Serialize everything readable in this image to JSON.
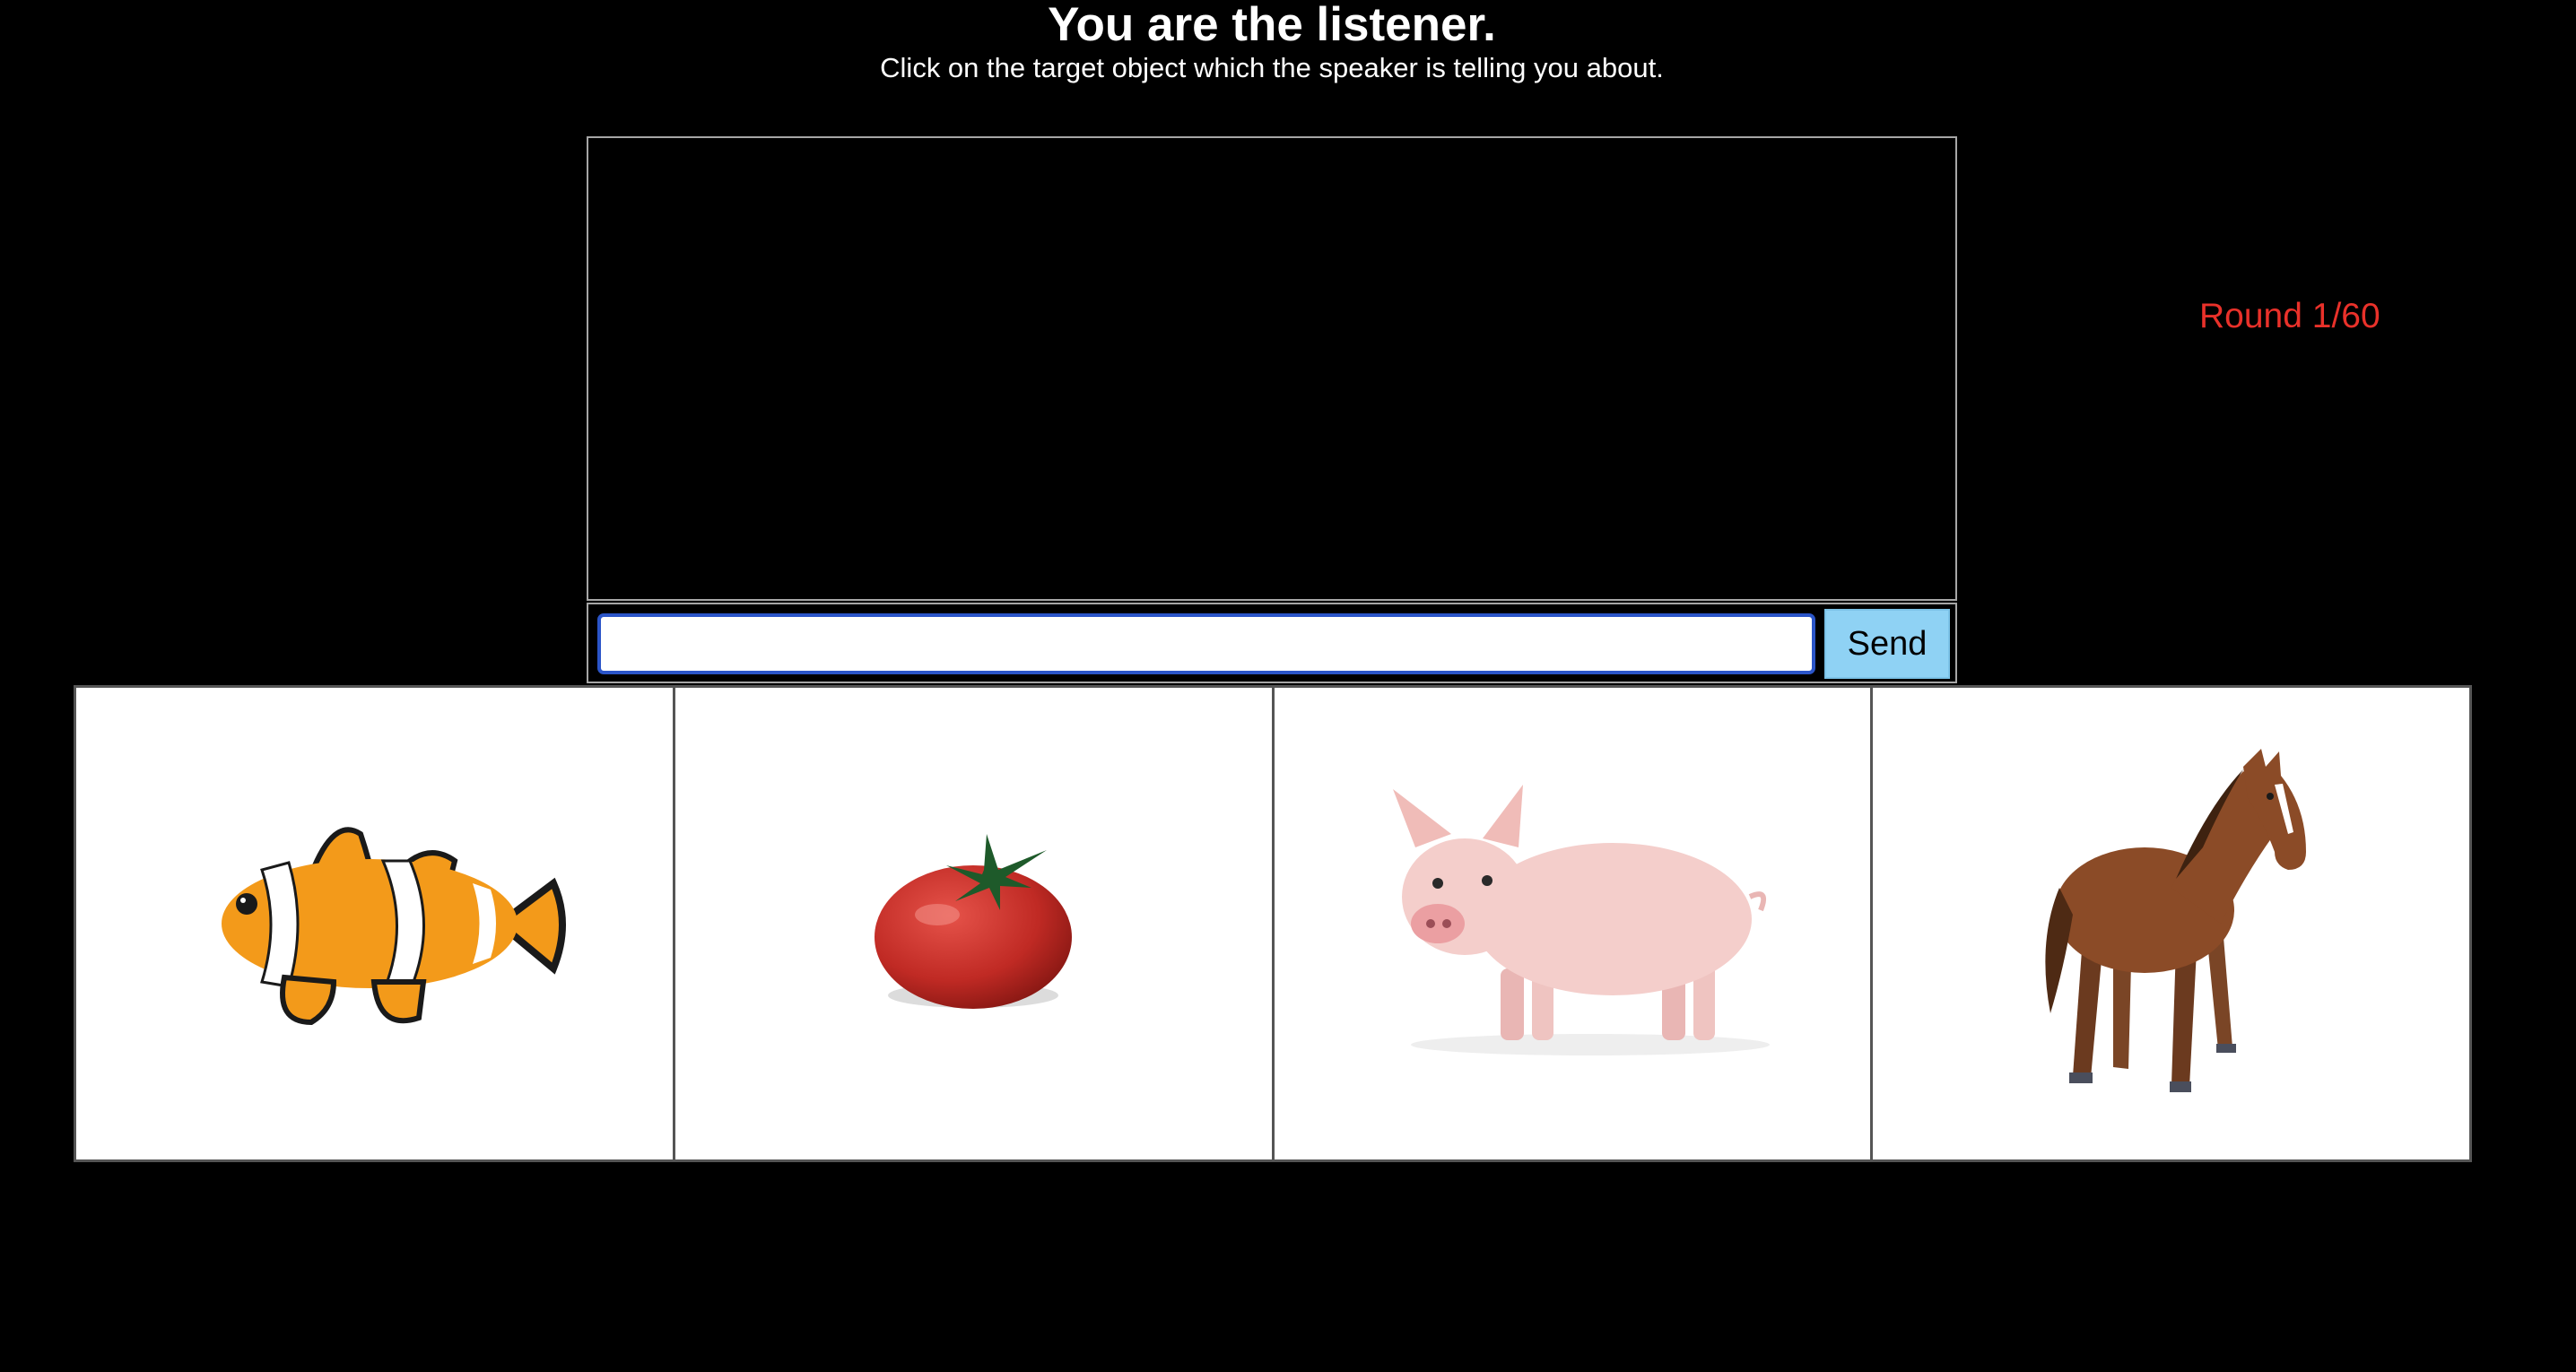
{
  "header": {
    "title": "You are the listener.",
    "instruction": "Click on the target object which the speaker is telling you about."
  },
  "chat": {
    "input_value": "",
    "send_label": "Send"
  },
  "status": {
    "round_label": "Round 1/60",
    "round_color": "#e9312a"
  },
  "objects": [
    {
      "name": "clownfish",
      "icon": "clownfish-icon"
    },
    {
      "name": "tomato",
      "icon": "tomato-icon"
    },
    {
      "name": "pig",
      "icon": "pig-icon"
    },
    {
      "name": "horse",
      "icon": "horse-icon"
    }
  ]
}
